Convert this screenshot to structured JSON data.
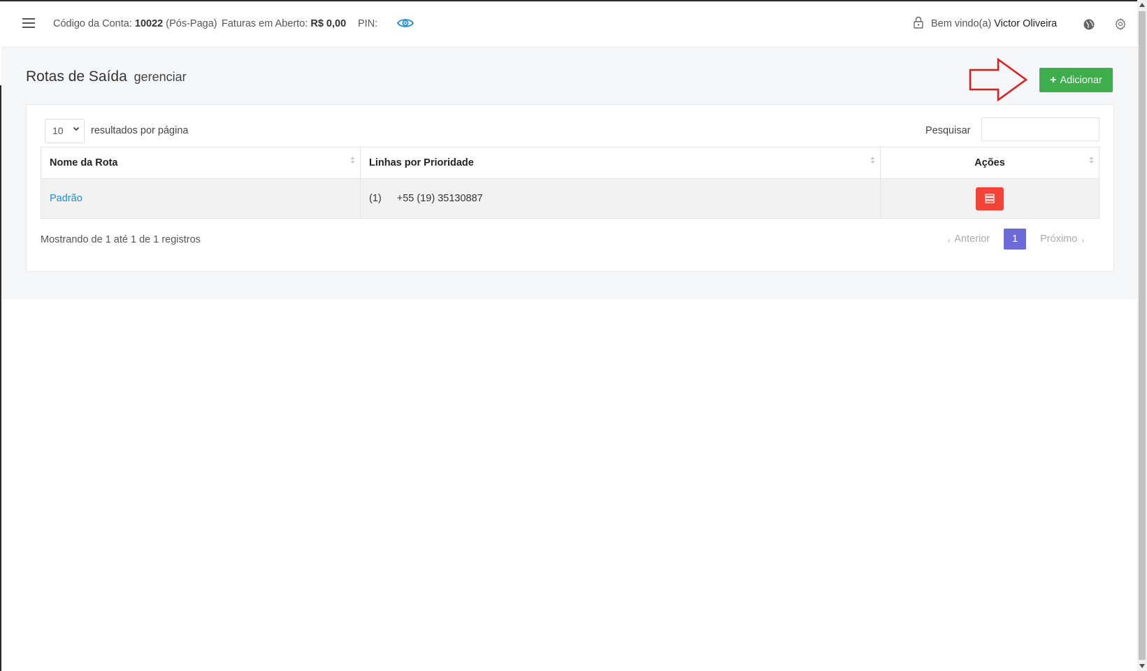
{
  "topbar": {
    "account_label": "Código da Conta:",
    "account_code": "10022",
    "account_type": "(Pós-Paga)",
    "invoices_label": "Faturas em Aberto:",
    "invoices_value": "R$ 0,00",
    "pin_label": "PIN:",
    "welcome_label": "Bem vindo(a)",
    "user_name": "Victor Oliveira"
  },
  "page": {
    "title": "Rotas de Saída",
    "subtitle": "gerenciar",
    "add_button": "Adicionar"
  },
  "table_controls": {
    "page_length": "10",
    "page_length_label": "resultados por página",
    "search_label": "Pesquisar",
    "search_value": ""
  },
  "table": {
    "columns": [
      "Nome da Rota",
      "Linhas por Prioridade",
      "Ações"
    ],
    "rows": [
      {
        "route_name": "Padrão",
        "priority": "(1)",
        "line": "+55 (19) 35130887"
      }
    ]
  },
  "footer": {
    "info": "Mostrando de 1 até 1 de 1 registros",
    "prev": "Anterior",
    "current_page": "1",
    "next": "Próximo"
  },
  "colors": {
    "add_button": "#3dae4b",
    "delete_button": "#f44336",
    "pager_active": "#6c6bd9",
    "link": "#1b8fd8",
    "annotation_arrow": "#e01b1b"
  }
}
